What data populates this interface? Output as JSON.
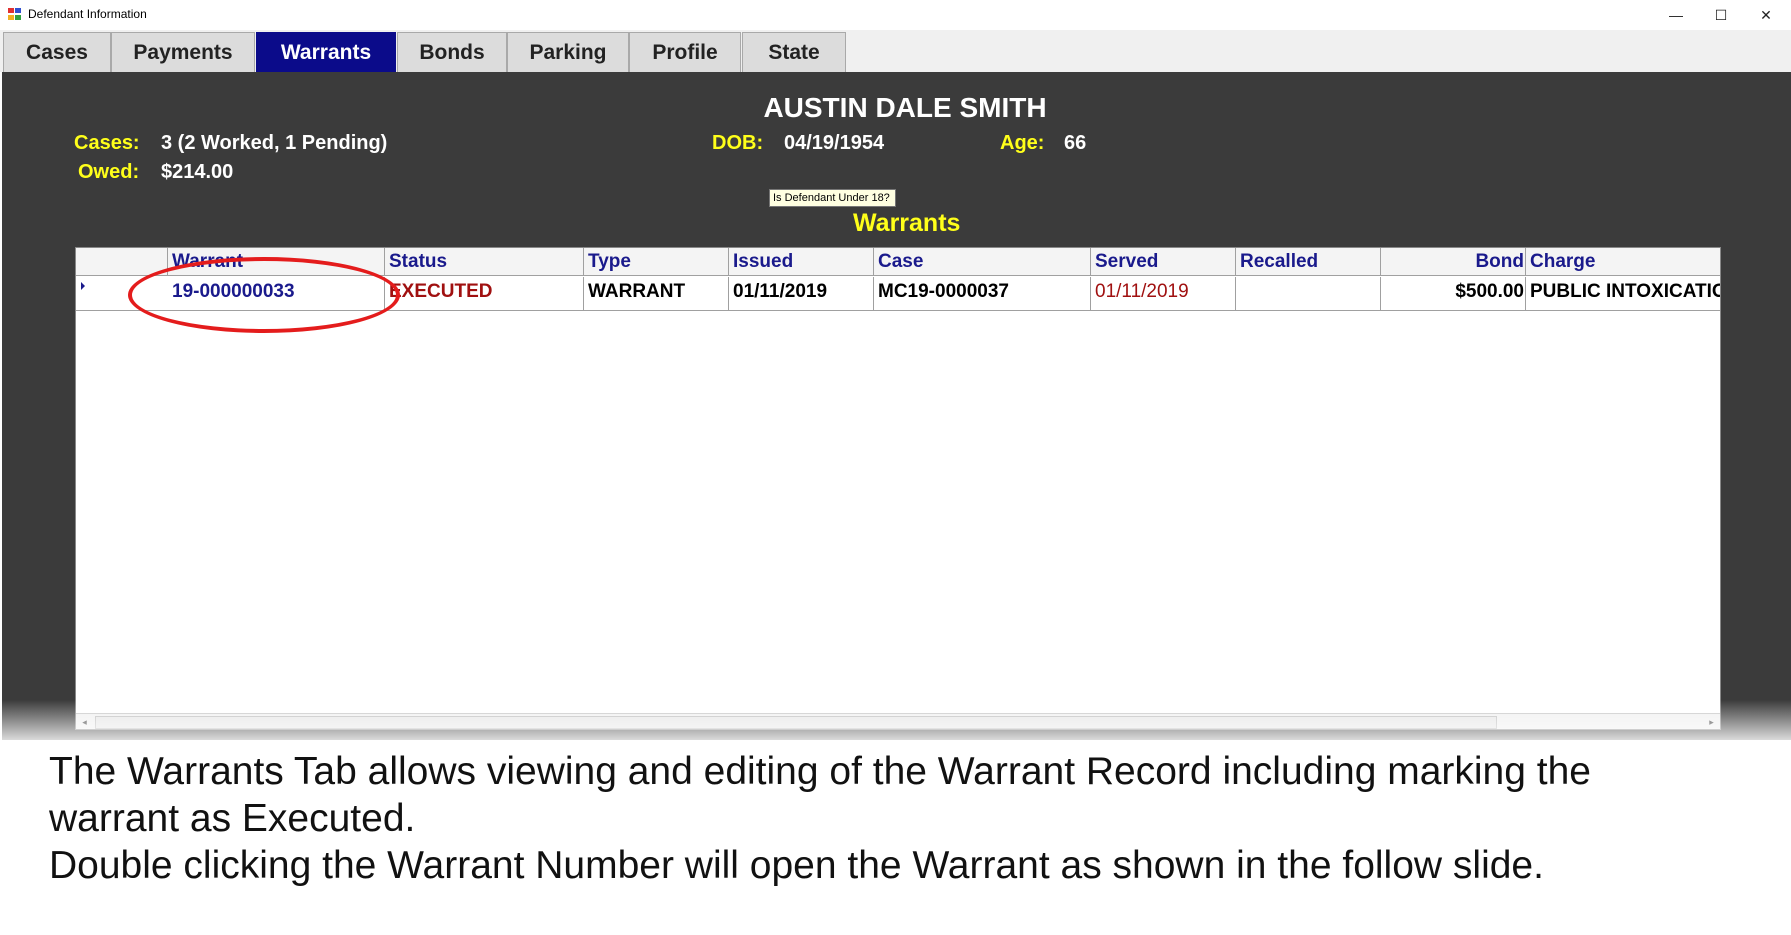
{
  "window": {
    "title": "Defendant Information",
    "minimize": "—",
    "maximize": "☐",
    "close": "✕",
    "icon": "app-form-icon"
  },
  "tabs": [
    {
      "label": "Cases",
      "active": false
    },
    {
      "label": "Payments",
      "active": false
    },
    {
      "label": "Warrants",
      "active": true
    },
    {
      "label": "Bonds",
      "active": false
    },
    {
      "label": "Parking",
      "active": false
    },
    {
      "label": "Profile",
      "active": false
    },
    {
      "label": "State",
      "active": false
    }
  ],
  "defendant": {
    "name": "AUSTIN DALE SMITH",
    "cases_label": "Cases:",
    "cases_value": "3 (2 Worked, 1 Pending)",
    "owed_label": "Owed:",
    "owed_value": "$214.00",
    "dob_label": "DOB:",
    "dob_value": "04/19/1954",
    "age_label": "Age:",
    "age_value": "66"
  },
  "tooltip": "Is Defendant Under 18?",
  "section_title": "Warrants",
  "grid": {
    "columns": [
      "Warrant",
      "Status",
      "Type",
      "Issued",
      "Case",
      "Served",
      "Recalled",
      "Bond",
      "Charge"
    ],
    "rows": [
      {
        "warrant": "19-000000033",
        "status": "EXECUTED",
        "type": "WARRANT",
        "issued": "01/11/2019",
        "case": "MC19-0000037",
        "served": "01/11/2019",
        "recalled": "",
        "bond": "$500.00",
        "charge": "PUBLIC INTOXICATION"
      }
    ],
    "scroll_left": "◂",
    "scroll_right": "▸"
  },
  "colors": {
    "active_tab": "#0b0b8a",
    "label_yellow": "#ffff1a",
    "panel": "#3b3b3b",
    "status_red": "#a01010",
    "header_blue": "#1a1a8c",
    "annotation_red": "#e41c1c"
  },
  "caption": {
    "line1": "The Warrants Tab allows viewing and editing of the Warrant Record including marking the",
    "line2": "warrant as Executed.",
    "line3": "Double clicking the Warrant Number will open the Warrant as shown in the follow slide."
  }
}
